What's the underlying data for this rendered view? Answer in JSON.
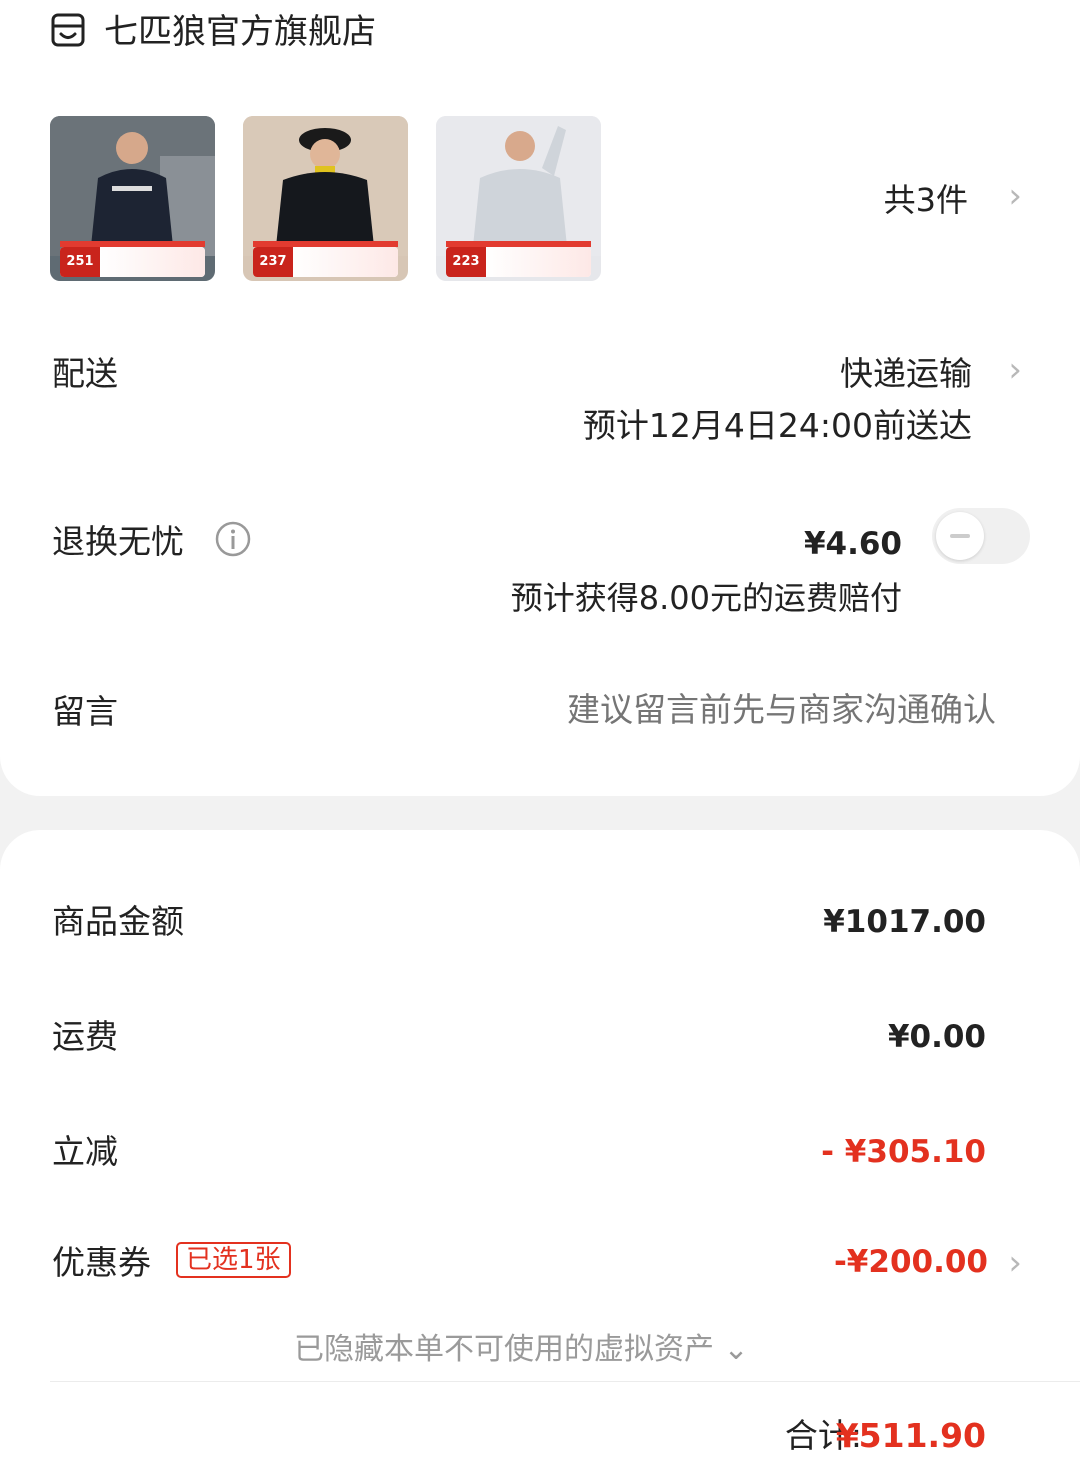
{
  "store": {
    "name": "七匹狼官方旗舰店"
  },
  "products": {
    "items": [
      {
        "price_tag": "251"
      },
      {
        "price_tag": "237"
      },
      {
        "price_tag": "223"
      }
    ],
    "count_label": "共3件"
  },
  "delivery": {
    "label": "配送",
    "method": "快递运输",
    "eta": "预计12月4日24:00前送达"
  },
  "return_insurance": {
    "label": "退换无忧",
    "price": "¥4.60",
    "description": "预计获得8.00元的运费赔付",
    "enabled": false
  },
  "message": {
    "label": "留言",
    "placeholder": "建议留言前先与商家沟通确认"
  },
  "summary": {
    "goods_label": "商品金额",
    "goods_value": "¥1017.00",
    "shipping_label": "运费",
    "shipping_value": "¥0.00",
    "discount_label": "立减",
    "discount_value": "- ¥305.10",
    "coupon_label": "优惠券",
    "coupon_badge": "已选1张",
    "coupon_value": "-¥200.00",
    "hidden_assets": "已隐藏本单不可使用的虚拟资产 ⌄",
    "total_label": "合计:",
    "total_value": "¥511.90"
  },
  "colors": {
    "accent_red": "#e3311f",
    "muted_text": "#9a9a9a",
    "placeholder": "#bdbdbd"
  },
  "icons": [
    "store-icon",
    "chevron-right-icon",
    "info-icon",
    "chevron-down-icon"
  ]
}
